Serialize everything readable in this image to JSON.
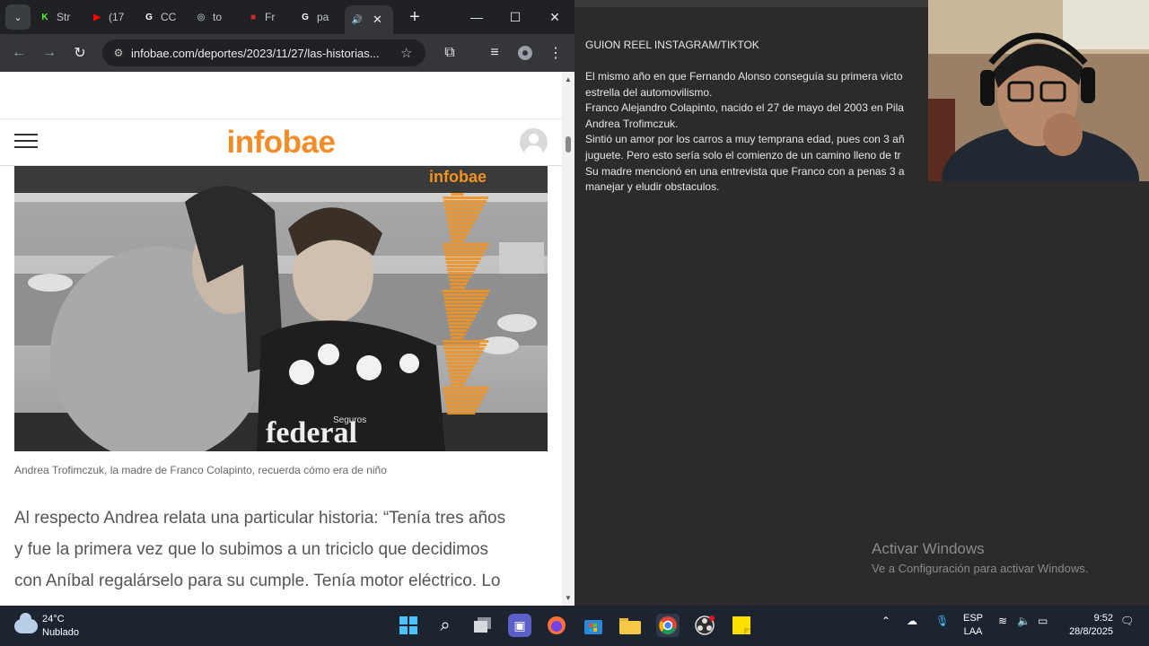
{
  "browser": {
    "tabs": [
      {
        "label": "Str",
        "icon": "kick-icon",
        "color": "#53fc18",
        "glyph": "K"
      },
      {
        "label": "(17",
        "icon": "youtube-icon",
        "color": "#ff0000",
        "glyph": "▶"
      },
      {
        "label": "CC",
        "icon": "google-icon",
        "color": "#ffffff",
        "glyph": "G"
      },
      {
        "label": "to",
        "icon": "globe-icon",
        "color": "#9aa0a6",
        "glyph": "◎"
      },
      {
        "label": "Fr",
        "icon": "flag-icon",
        "color": "#cc2b2b",
        "glyph": "■"
      },
      {
        "label": "pa",
        "icon": "google-icon",
        "color": "#ffffff",
        "glyph": "G"
      },
      {
        "label": "",
        "icon": "audio-icon",
        "color": "#e8eaed",
        "glyph": "🔊"
      }
    ],
    "new_tab_glyph": "+",
    "window_controls": {
      "minimize": "—",
      "maximize": "☐",
      "close": "✕"
    },
    "toolbar": {
      "back": "←",
      "forward": "→",
      "reload": "↻"
    },
    "url": "infobae.com/deportes/2023/11/27/las-historias...",
    "url_icon": "site-settings-icon"
  },
  "site": {
    "logo": "infobae",
    "caption": "Andrea Trofimczuk, la madre de Franco Colapinto, recuerda cómo era de niño",
    "watermark": "infobae",
    "shirt_text": "federal",
    "shirt_small": "Seguros",
    "article_lines": [
      "Al respecto Andrea relata una particular historia: “Tenía tres años",
      "y fue la primera vez que lo subimos a un triciclo que decidimos",
      "con Aníbal regalárselo para su cumple. Tenía motor eléctrico. Lo"
    ]
  },
  "editor": {
    "title": "GUION REEL INSTAGRAM/TIKTOK",
    "lines": [
      "El mismo año en que Fernando Alonso conseguía su primera victo",
      "estrella del automovilismo.",
      "Franco Alejandro Colapinto, nacido el 27 de mayo del 2003 en Pila",
      "Andrea Trofimczuk.",
      "Sintió un amor por los carros a muy temprana edad, pues con 3 añ",
      "juguete. Pero esto sería solo el comienzo de un camino lleno de tr",
      "Su madre mencionó en una entrevista que Franco con a penas 3 a",
      "manejar y eludir obstaculos."
    ]
  },
  "watermark": {
    "line1": "Activar Windows",
    "line2": "Ve a Configuración para activar Windows."
  },
  "taskbar": {
    "weather_temp": "24°C",
    "weather_desc": "Nublado",
    "lang_top": "ESP",
    "lang_bottom": "LAA",
    "time": "9:52",
    "date": "28/8/2025"
  }
}
